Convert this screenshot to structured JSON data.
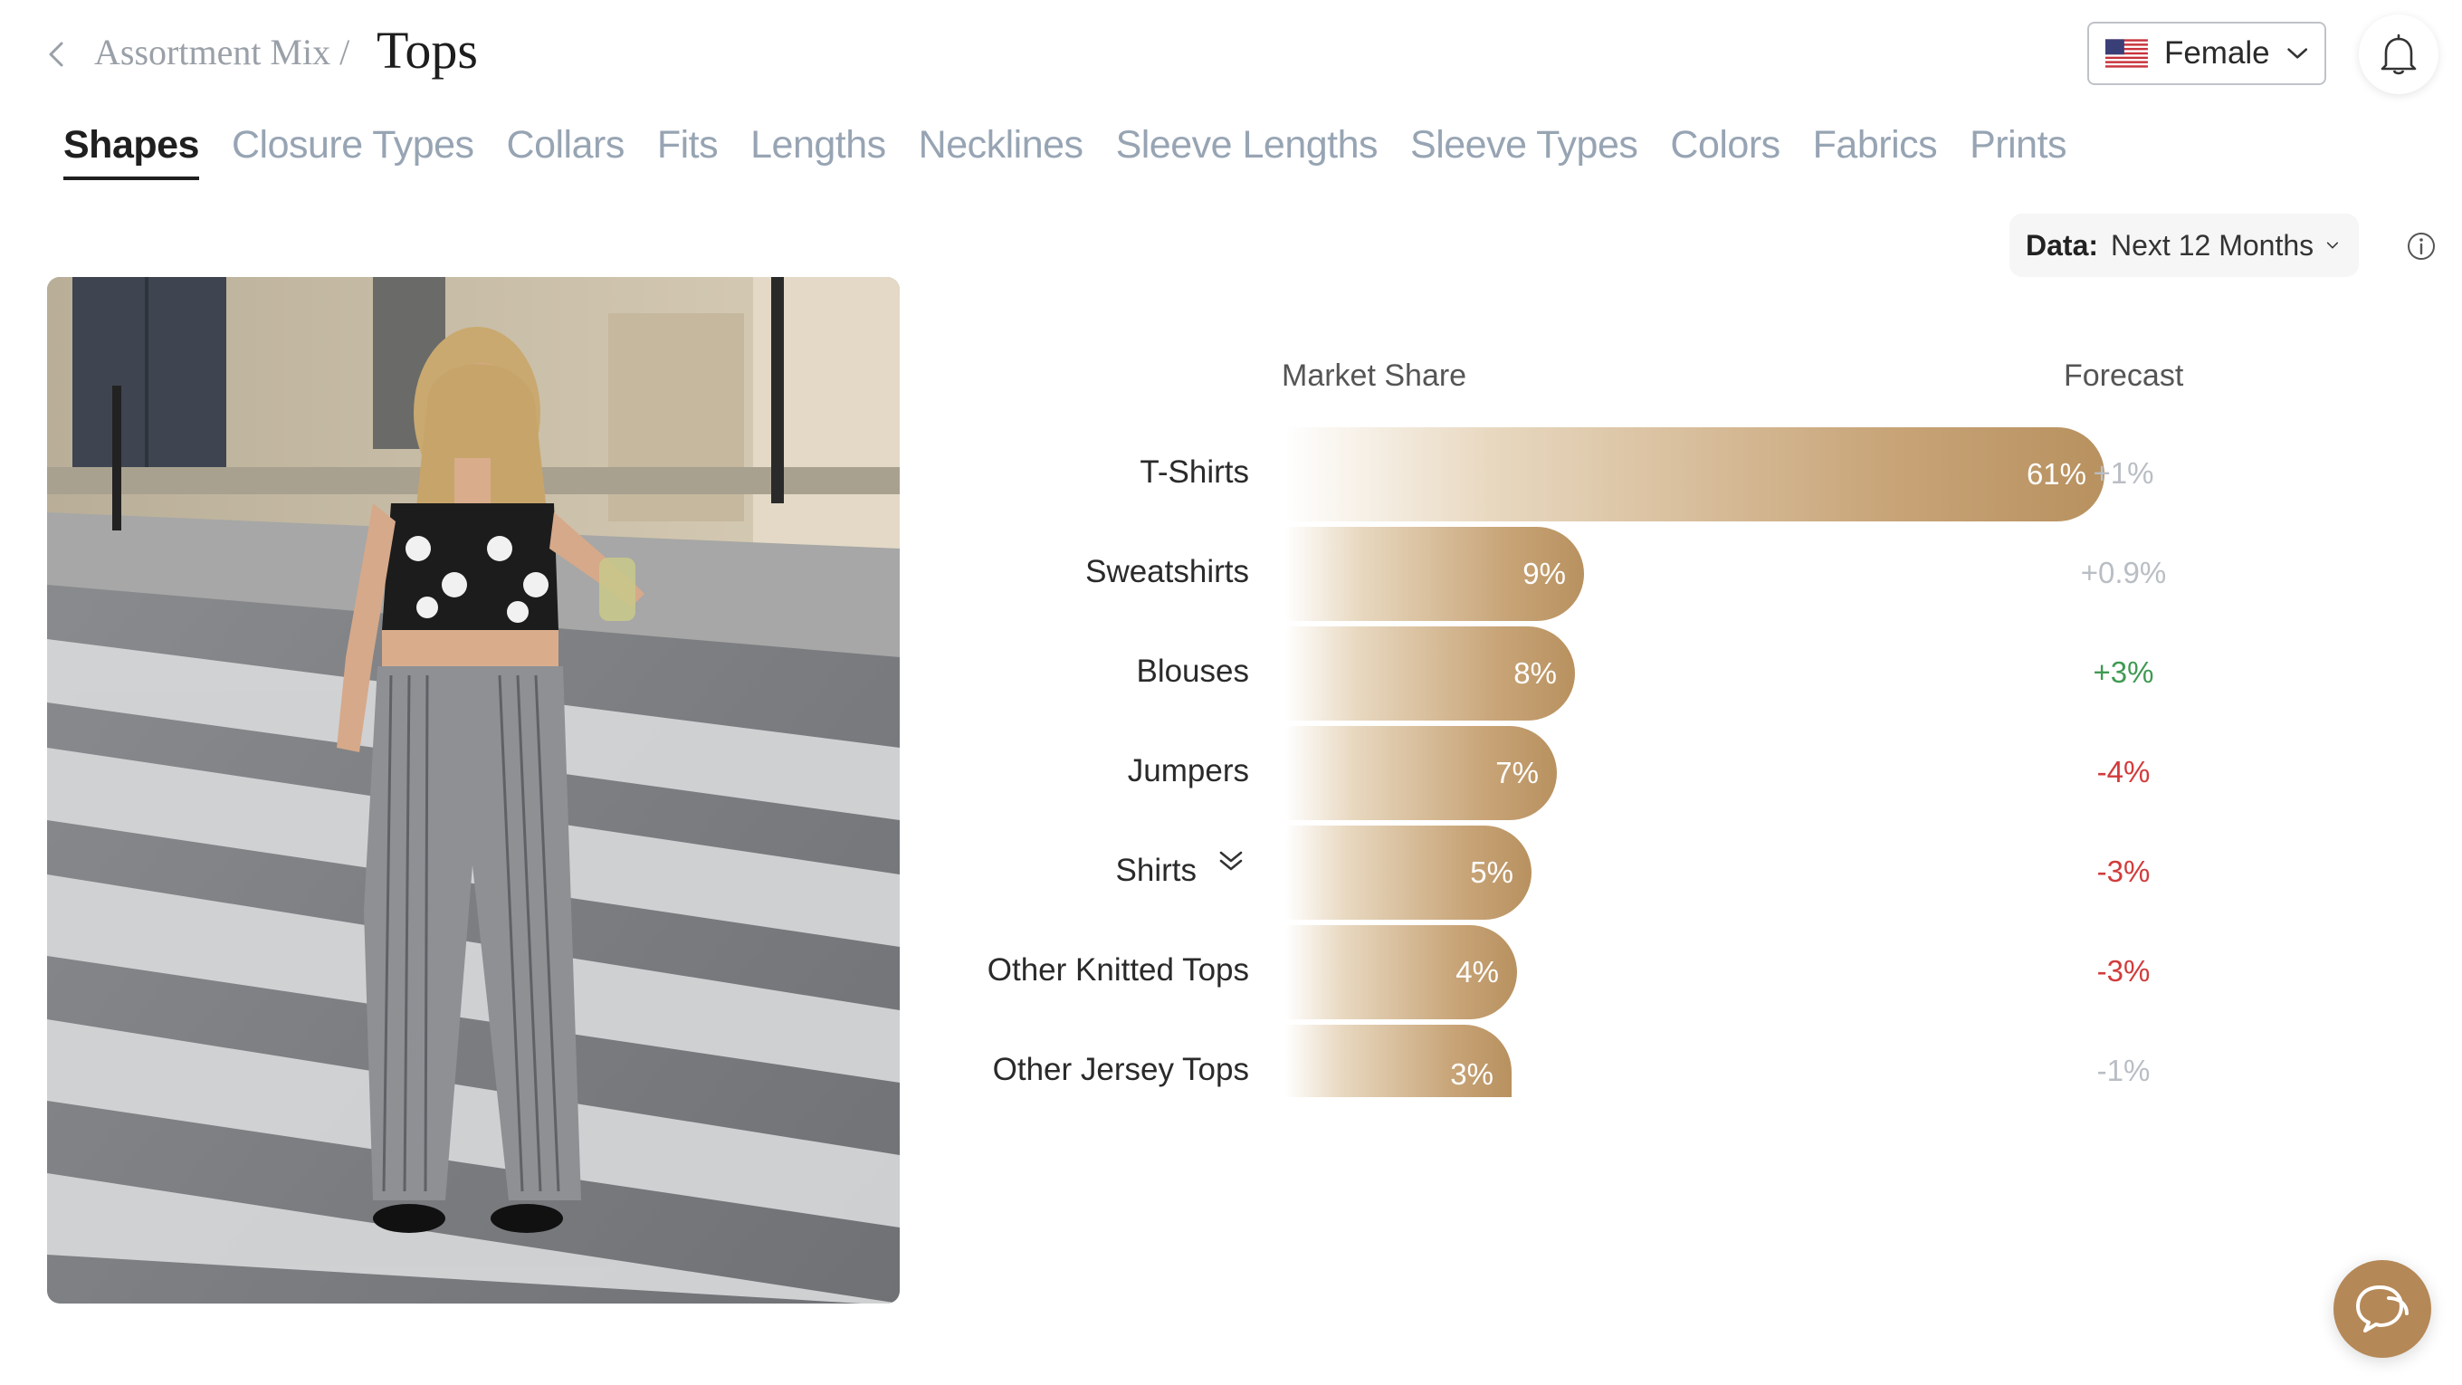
{
  "header": {
    "breadcrumb_parent": "Assortment Mix /",
    "title": "Tops",
    "gender_value": "Female"
  },
  "tabs": [
    {
      "label": "Shapes",
      "active": true
    },
    {
      "label": "Closure Types"
    },
    {
      "label": "Collars"
    },
    {
      "label": "Fits"
    },
    {
      "label": "Lengths"
    },
    {
      "label": "Necklines"
    },
    {
      "label": "Sleeve Lengths"
    },
    {
      "label": "Sleeve Types"
    },
    {
      "label": "Colors"
    },
    {
      "label": "Fabrics"
    },
    {
      "label": "Prints"
    }
  ],
  "data_selector": {
    "key": "Data:",
    "value": "Next 12 Months"
  },
  "chart_data": {
    "type": "bar",
    "orientation": "horizontal",
    "columns": {
      "share": "Market Share",
      "forecast": "Forecast"
    },
    "categories": [
      "T-Shirts",
      "Sweatshirts",
      "Blouses",
      "Jumpers",
      "Shirts",
      "Other Knitted Tops",
      "Other Jersey Tops"
    ],
    "values": [
      61,
      9,
      8,
      7,
      5,
      4,
      3
    ],
    "value_labels": [
      "61%",
      "9%",
      "8%",
      "7%",
      "5%",
      "4%",
      "3%"
    ],
    "forecast": [
      "+1%",
      "+0.9%",
      "+3%",
      "-4%",
      "-3%",
      "-3%",
      "-1%"
    ],
    "forecast_colors": [
      "#b9bec4",
      "#b9bec4",
      "#3f9a52",
      "#d23b3b",
      "#d23b3b",
      "#d23b3b",
      "#b9bec4"
    ]
  },
  "colors": {
    "accent": "#b58857",
    "tab_inactive": "#97a4b3"
  }
}
